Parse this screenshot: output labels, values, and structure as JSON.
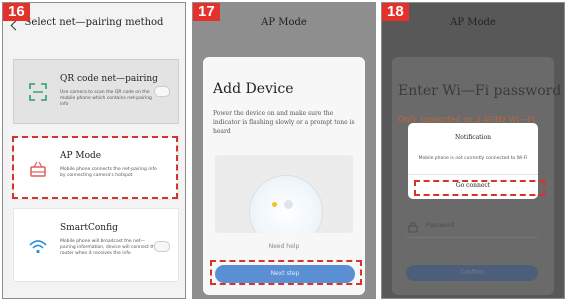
{
  "panels": [
    {
      "step": "16",
      "header": "Select net—pairing method",
      "options": [
        {
          "title": "QR code net—pairing",
          "desc": "Use camera to scan the QR code on the mobile phone which contains net-pairing info",
          "icon": "qr-scan-icon"
        },
        {
          "title": "AP Mode",
          "desc": "Mobile phone connects the net-pairing info by connecting camera's hotspot",
          "icon": "router-icon"
        },
        {
          "title": "SmartConfig",
          "desc": "Mobile phone will broadcast the net—pairing information, device will connect the router when it receives the info",
          "icon": "wifi-icon"
        }
      ]
    },
    {
      "step": "17",
      "header": "AP Mode",
      "title": "Add Device",
      "desc": "Power the device on and make sure the indicator is flashing slowly or a prompt tone is heard",
      "need_help": "Need help",
      "next": "Next step"
    },
    {
      "step": "18",
      "header": "AP Mode",
      "title": "Enter Wi—Fi password",
      "only_supported": "Only supported on 2.4GHz Wi—Fi",
      "notification": {
        "title": "Notification",
        "message": "Mobile phone is not currently connected to Wi-Fi",
        "action": "Go connect"
      },
      "password_label": "Password",
      "confirm": "Confirm"
    }
  ],
  "colors": {
    "step_badge": "#e5312b",
    "highlight": "#d5342c",
    "next_button": "#5b8fd4"
  }
}
